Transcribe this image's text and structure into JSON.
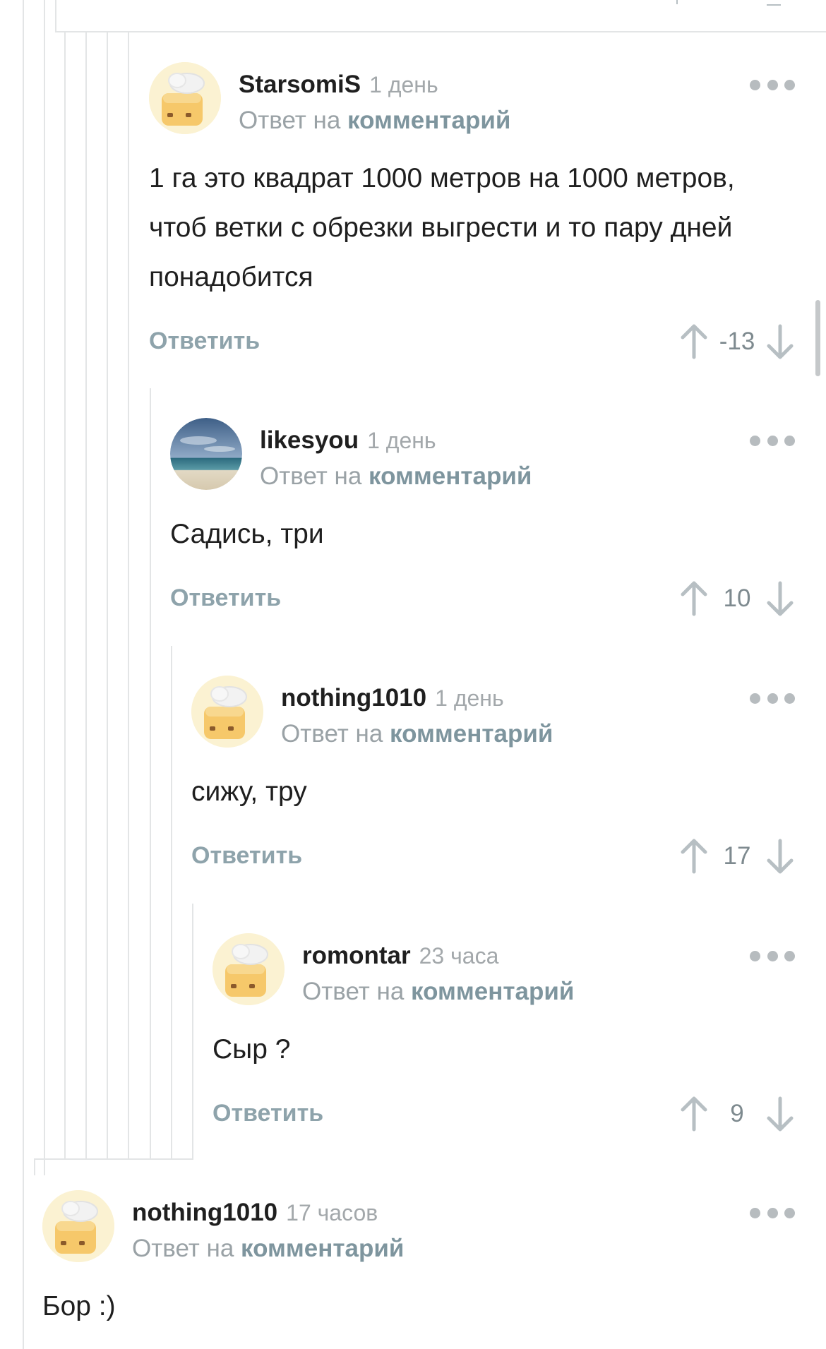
{
  "comments": [
    {
      "username": "StarsomiS",
      "time": "1 день",
      "reply_prefix": "Ответ на",
      "reply_link": "комментарий",
      "text": "1 га это квадрат 1000 метров на 1000 метров, чтоб ветки с обрезки выгрести и то пару дней понадобится",
      "reply_label": "Ответить",
      "score": "-13",
      "avatar": "toast-chef-avatar"
    },
    {
      "username": "likesyou",
      "time": "1 день",
      "reply_prefix": "Ответ на",
      "reply_link": "комментарий",
      "text": "Садись, три",
      "reply_label": "Ответить",
      "score": "10",
      "avatar": "beach-photo-avatar"
    },
    {
      "username": "nothing1010",
      "time": "1 день",
      "reply_prefix": "Ответ на",
      "reply_link": "комментарий",
      "text": "сижу, тру",
      "reply_label": "Ответить",
      "score": "17",
      "avatar": "toast-chef-avatar"
    },
    {
      "username": "romontar",
      "time": "23 часа",
      "reply_prefix": "Ответ на",
      "reply_link": "комментарий",
      "text": "Сыр ?",
      "reply_label": "Ответить",
      "score": "9",
      "avatar": "toast-chef-avatar"
    },
    {
      "username": "nothing1010",
      "time": "17 часов",
      "reply_prefix": "Ответ на",
      "reply_link": "комментарий",
      "text": "Бор :)",
      "avatar": "toast-chef-avatar"
    }
  ],
  "icons": {
    "upvote": "arrow-up-icon",
    "downvote": "arrow-down-icon",
    "more": "more-dots-icon"
  },
  "colors": {
    "thread_line": "#e3e5e6",
    "link": "#7e959e",
    "muted": "#9aa2a6"
  }
}
